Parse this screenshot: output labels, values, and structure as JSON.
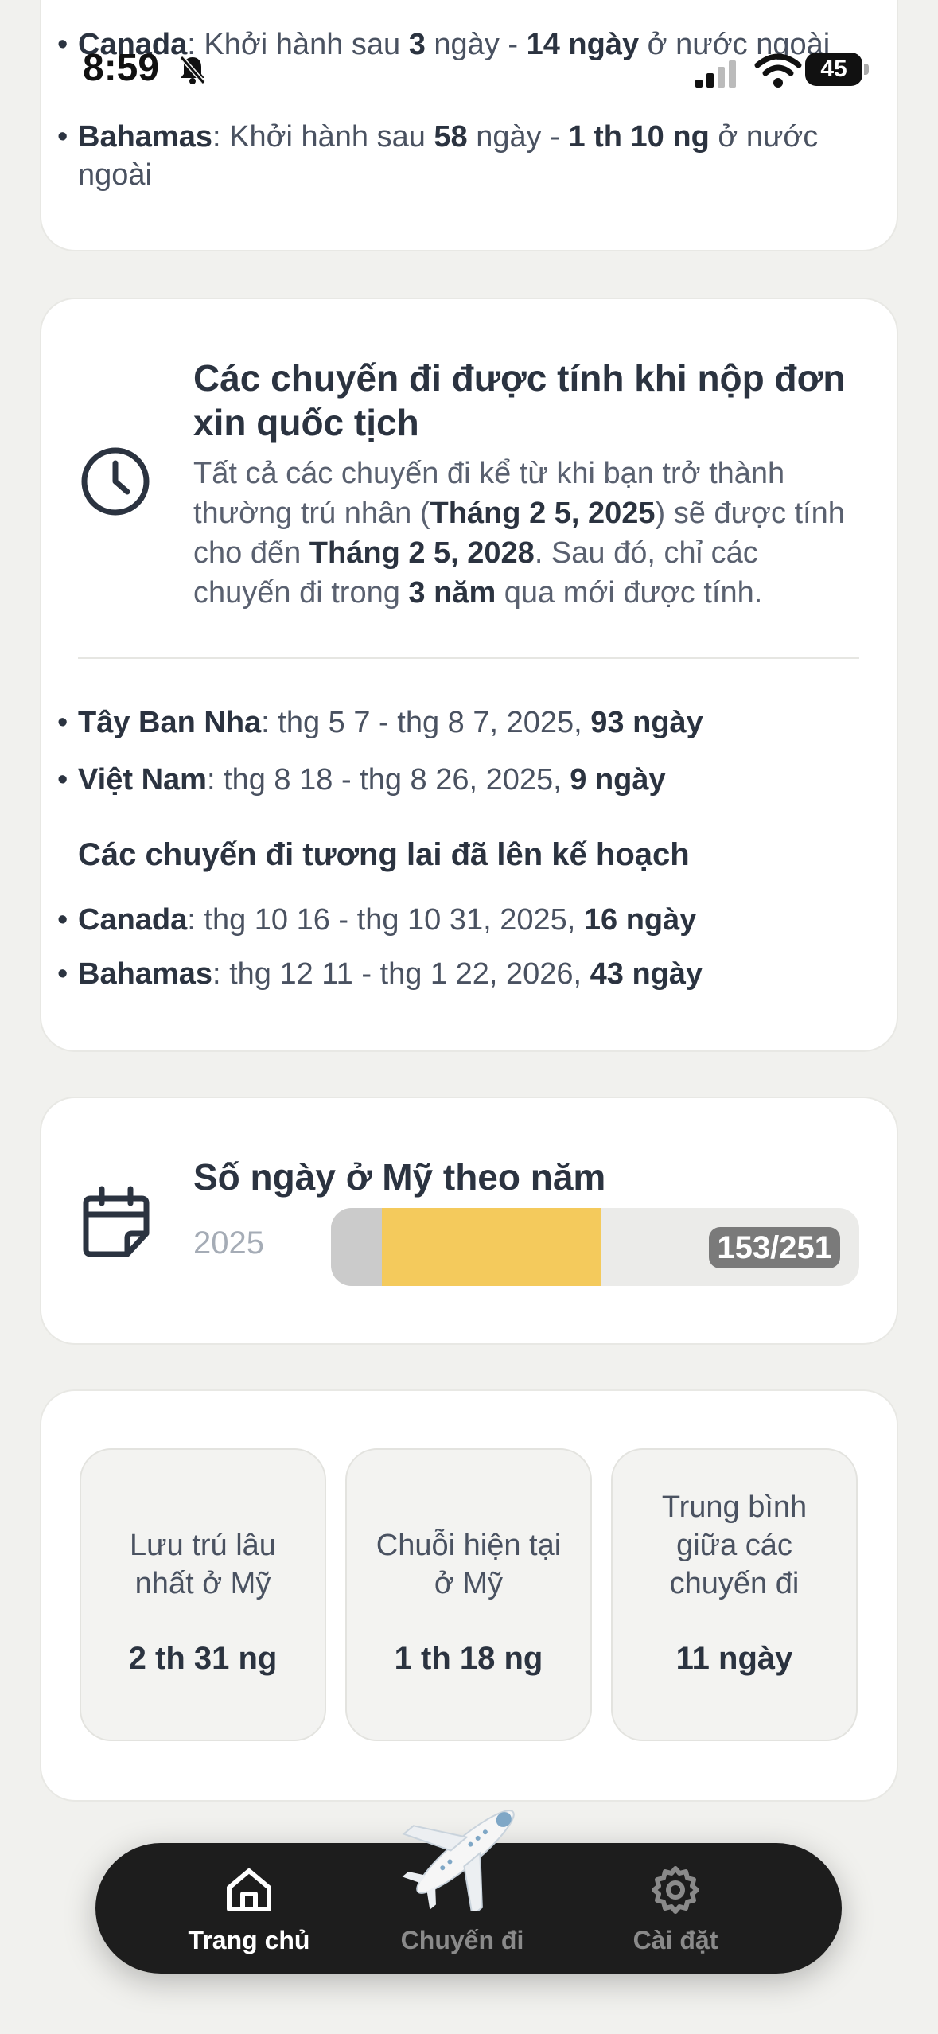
{
  "status_bar": {
    "time": "8:59",
    "battery": "45"
  },
  "card_top": {
    "items": [
      {
        "country": "Canada",
        "sep": ": Khởi hành sau ",
        "days": "3",
        "mid": " ngày - ",
        "stay": "14 ngày",
        "tail": " ở nước ngoài"
      },
      {
        "country": "Bahamas",
        "sep": ": Khởi hành sau ",
        "days": "58",
        "mid": " ngày - ",
        "stay": "1 th 10 ng",
        "tail": " ở nước ngoài"
      }
    ]
  },
  "citizenship_card": {
    "title": "Các chuyến đi được tính khi nộp đơn xin quốc tịch",
    "desc_parts": {
      "p1": "Tất cả các chuyến đi kể từ khi bạn trở thành thường trú nhân (",
      "date1": "Tháng 2 5, 2025",
      "p2": ") sẽ được tính cho đến ",
      "date2": "Tháng 2 5, 2028",
      "p3": ". Sau đó, chỉ các chuyến đi trong ",
      "years": "3 năm",
      "p4": " qua mới được tính."
    },
    "past_trips": [
      {
        "country": "Tây Ban Nha",
        "range": ": thg 5 7 - thg 8 7, 2025, ",
        "days": "93 ngày"
      },
      {
        "country": "Việt Nam",
        "range": ": thg 8 18 - thg 8 26, 2025, ",
        "days": "9 ngày"
      }
    ],
    "future_heading": "Các chuyến đi tương lai đã lên kế hoạch",
    "future_trips": [
      {
        "country": "Canada",
        "range": ": thg 10 16 - thg 10 31, 2025, ",
        "days": "16 ngày"
      },
      {
        "country": "Bahamas",
        "range": ": thg 12 11 - thg 1 22, 2026, ",
        "days": "43 ngày"
      }
    ]
  },
  "days_card": {
    "title": "Số ngày ở Mỹ theo năm",
    "year": "2025",
    "label": "153/251",
    "progress_fraction": 0.61
  },
  "stats": [
    {
      "label": "Lưu trú lâu nhất ở Mỹ",
      "value": "2 th 31 ng"
    },
    {
      "label": "Chuỗi hiện tại ở Mỹ",
      "value": "1 th 18 ng"
    },
    {
      "label": "Trung bình giữa các chuyến đi",
      "value": "11 ngày"
    }
  ],
  "nav": {
    "home": "Trang chủ",
    "trips": "Chuyến đi",
    "settings": "Cài đặt"
  },
  "colors": {
    "accent": "#f4ca5c",
    "text": "#2b3340",
    "nav_bg": "#1d1d1d"
  }
}
